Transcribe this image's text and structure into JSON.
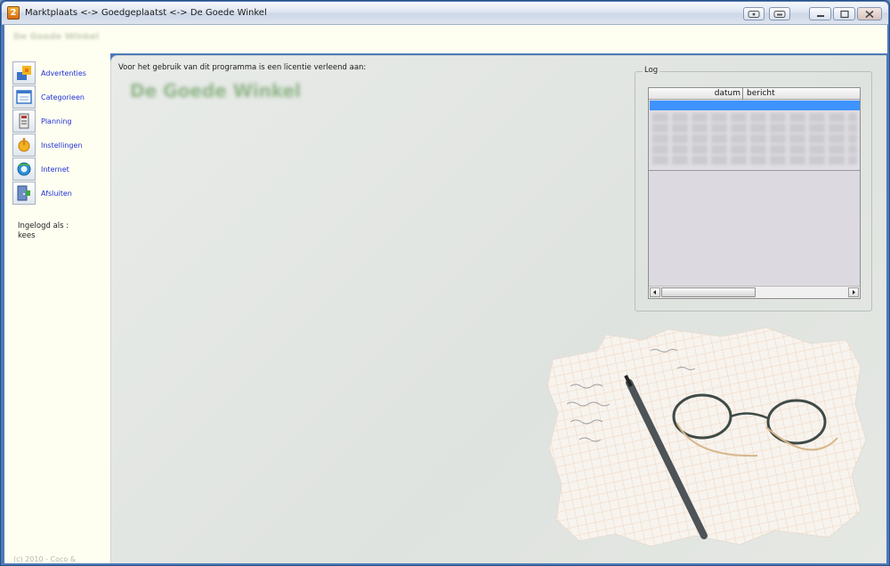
{
  "window": {
    "title": "Marktplaats <-> Goedgeplaatst <-> De Goede Winkel",
    "shop_name": "De Goede Winkel"
  },
  "sidebar": {
    "items": [
      {
        "label": "Advertenties",
        "icon": "advertisements-icon"
      },
      {
        "label": "Categorieen",
        "icon": "categories-icon"
      },
      {
        "label": "Planning",
        "icon": "planning-icon"
      },
      {
        "label": "Instellingen",
        "icon": "settings-icon"
      },
      {
        "label": "Internet",
        "icon": "internet-icon"
      },
      {
        "label": "Afsluiten",
        "icon": "exit-icon"
      }
    ],
    "logged_in_label": "Ingelogd als :",
    "logged_in_user": "kees",
    "copyright": "(c) 2010 - Coco &"
  },
  "main": {
    "licence_text": "Voor het gebruik van dit programma is een licentie verleend aan:",
    "licence_shop": "De Goede Winkel"
  },
  "log": {
    "group_title": "Log",
    "columns": {
      "datum": "datum",
      "bericht": "bericht"
    }
  },
  "colors": {
    "frame": "#4d79b8",
    "panel_cream": "#fefff1",
    "link_blue": "#1f2fd8",
    "selection_blue": "#3f93ff"
  }
}
